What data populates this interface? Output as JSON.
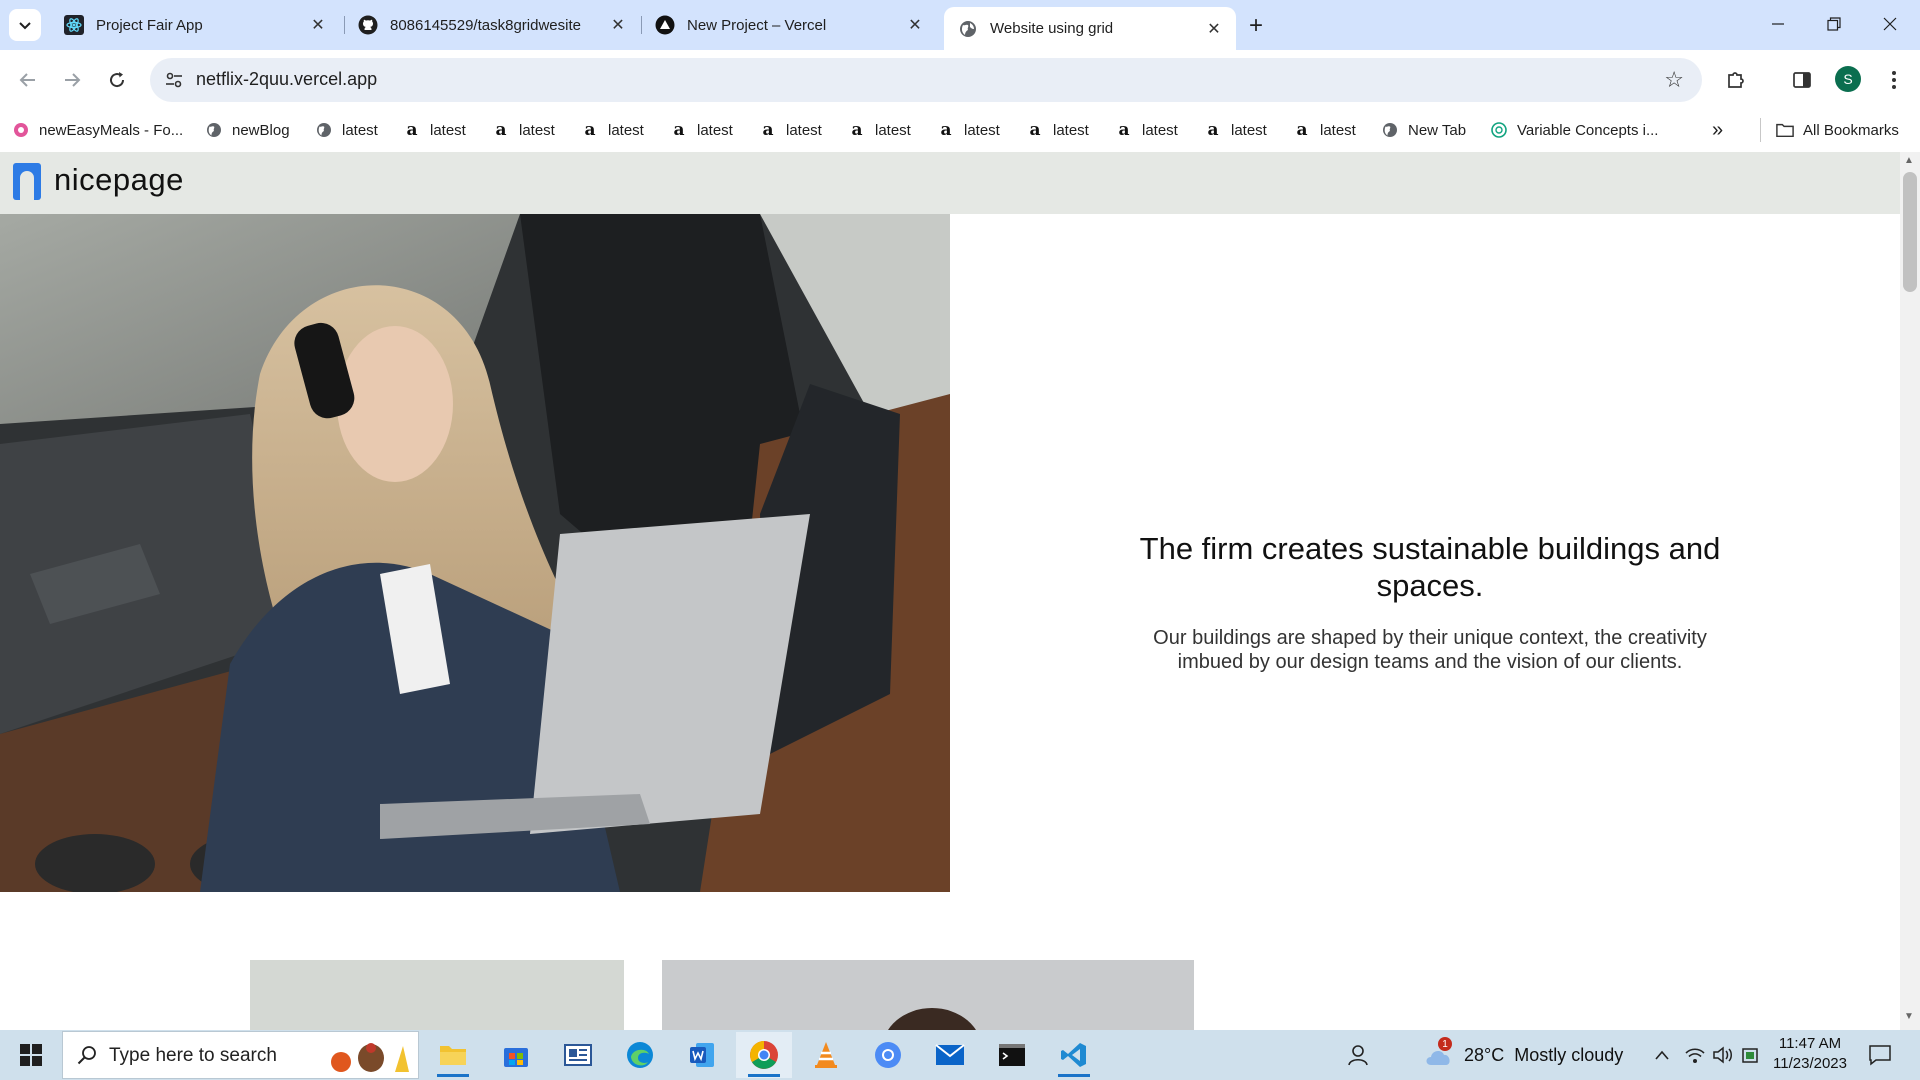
{
  "browser": {
    "tabs": [
      {
        "title": "Project Fair App",
        "icon": "react-icon",
        "active": false
      },
      {
        "title": "8086145529/task8gridwesite",
        "icon": "github-icon",
        "active": false
      },
      {
        "title": "New Project – Vercel",
        "icon": "vercel-icon",
        "active": false
      },
      {
        "title": "Website using grid",
        "icon": "globe-icon",
        "active": true
      }
    ],
    "url": "netflix-2quu.vercel.app",
    "profile_initial": "S",
    "bookmarks": [
      {
        "label": "newEasyMeals - Fo...",
        "icon": "easymeals-icon"
      },
      {
        "label": "newBlog",
        "icon": "globe-icon"
      },
      {
        "label": "latest",
        "icon": "globe-icon"
      },
      {
        "label": "latest",
        "icon": "amazon-icon"
      },
      {
        "label": "latest",
        "icon": "amazon-icon"
      },
      {
        "label": "latest",
        "icon": "amazon-icon"
      },
      {
        "label": "latest",
        "icon": "amazon-icon"
      },
      {
        "label": "latest",
        "icon": "amazon-icon"
      },
      {
        "label": "latest",
        "icon": "amazon-icon"
      },
      {
        "label": "latest",
        "icon": "amazon-icon"
      },
      {
        "label": "latest",
        "icon": "amazon-icon"
      },
      {
        "label": "latest",
        "icon": "amazon-icon"
      },
      {
        "label": "latest",
        "icon": "amazon-icon"
      },
      {
        "label": "latest",
        "icon": "amazon-icon"
      },
      {
        "label": "New Tab",
        "icon": "globe-icon"
      },
      {
        "label": "Variable Concepts i...",
        "icon": "chatgpt-icon"
      }
    ],
    "all_bookmarks_label": "All Bookmarks"
  },
  "page": {
    "logo_text": "nicepage",
    "hero_title": "The firm creates sustainable buildings and spaces.",
    "hero_body": "Our buildings are shaped by their unique context, the creativity imbued by our design teams and the vision of our clients.",
    "accent_color": "#2d7be5"
  },
  "taskbar": {
    "search_placeholder": "Type here to search",
    "weather_temp": "28°C",
    "weather_text": "Mostly cloudy",
    "notification_count": "1",
    "time": "11:47 AM",
    "date": "11/23/2023"
  }
}
